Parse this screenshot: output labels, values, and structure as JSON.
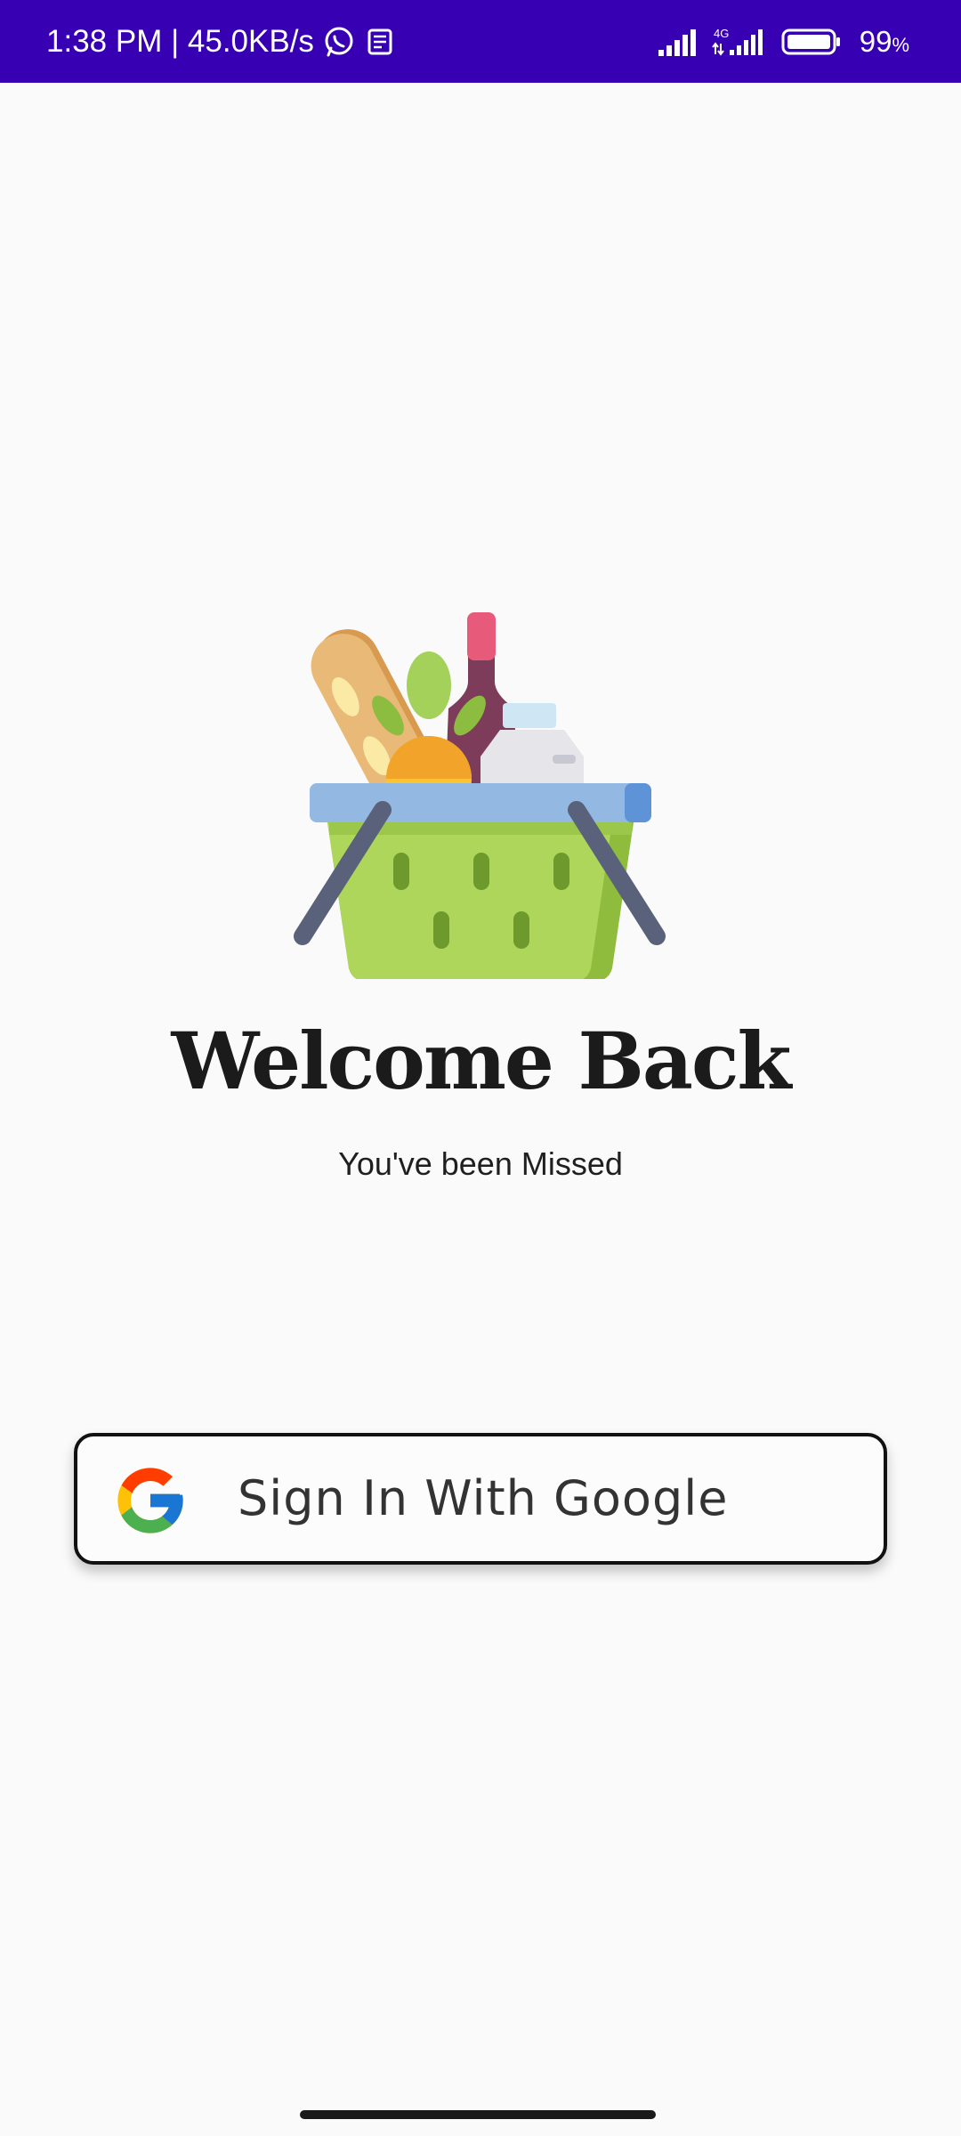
{
  "status_bar": {
    "time_speed": "1:38 PM | 45.0KB/s",
    "network_label": "4G",
    "battery_value": "99",
    "battery_unit": "%",
    "background_color": "#3700b3",
    "icons": [
      "whatsapp-icon",
      "news-icon",
      "signal-icon",
      "signal-4g-icon",
      "battery-icon"
    ]
  },
  "main": {
    "illustration": "grocery-basket-icon",
    "title": "Welcome Back",
    "subtitle": "You've been Missed",
    "google_button_label": "Sign In With Google"
  }
}
